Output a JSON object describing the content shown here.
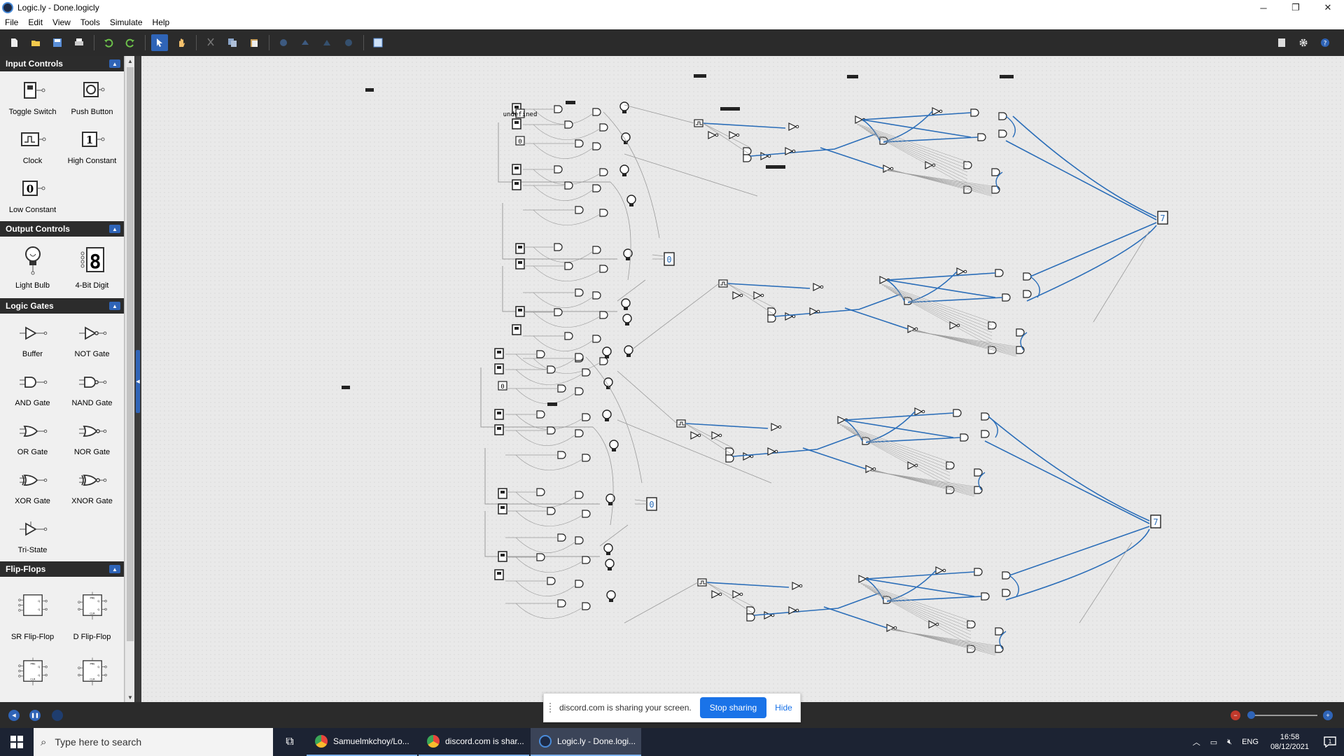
{
  "window": {
    "title": "Logic.ly - Done.logicly",
    "minimize": "─",
    "maximize": "❐",
    "close": "✕"
  },
  "menu": [
    "File",
    "Edit",
    "View",
    "Tools",
    "Simulate",
    "Help"
  ],
  "toolbar_icons": [
    "new-file-icon",
    "open-folder-icon",
    "save-icon",
    "print-icon",
    "undo-icon",
    "redo-icon",
    "select-pointer-icon",
    "pan-hand-icon",
    "cut-icon",
    "copy-icon",
    "paste-icon",
    "group-icon",
    "ungroup-icon",
    "rotate-icon",
    "flip-icon",
    "integrated-circuit-icon"
  ],
  "palette": {
    "sections": [
      {
        "title": "Input Controls",
        "items": [
          {
            "label": "Toggle Switch",
            "icon": "toggle-switch-icon"
          },
          {
            "label": "Push Button",
            "icon": "push-button-icon"
          },
          {
            "label": "Clock",
            "icon": "clock-icon"
          },
          {
            "label": "High Constant",
            "icon": "high-constant-icon",
            "glyph": "1"
          },
          {
            "label": "Low Constant",
            "icon": "low-constant-icon",
            "glyph": "0"
          }
        ]
      },
      {
        "title": "Output Controls",
        "items": [
          {
            "label": "Light Bulb",
            "icon": "light-bulb-icon"
          },
          {
            "label": "4-Bit Digit",
            "icon": "digit-display-icon",
            "glyph": "8"
          }
        ]
      },
      {
        "title": "Logic Gates",
        "items": [
          {
            "label": "Buffer",
            "icon": "buffer-gate-icon"
          },
          {
            "label": "NOT Gate",
            "icon": "not-gate-icon"
          },
          {
            "label": "AND Gate",
            "icon": "and-gate-icon"
          },
          {
            "label": "NAND Gate",
            "icon": "nand-gate-icon"
          },
          {
            "label": "OR Gate",
            "icon": "or-gate-icon"
          },
          {
            "label": "NOR Gate",
            "icon": "nor-gate-icon"
          },
          {
            "label": "XOR Gate",
            "icon": "xor-gate-icon"
          },
          {
            "label": "XNOR Gate",
            "icon": "xnor-gate-icon"
          },
          {
            "label": "Tri-State",
            "icon": "tri-state-icon"
          }
        ]
      },
      {
        "title": "Flip-Flops",
        "items": [
          {
            "label": "SR Flip-Flop",
            "icon": "sr-flip-flop-icon"
          },
          {
            "label": "D Flip-Flop",
            "icon": "d-flip-flop-icon"
          },
          {
            "label": "",
            "icon": "jk-flip-flop-icon"
          },
          {
            "label": "",
            "icon": "t-flip-flop-icon"
          }
        ]
      }
    ]
  },
  "circuit": {
    "constant_labels": [
      "0",
      "0"
    ],
    "digit_values": [
      "0",
      "0",
      "7",
      "7"
    ]
  },
  "share_banner": {
    "message": "discord.com is sharing your screen.",
    "stop_label": "Stop sharing",
    "hide_label": "Hide"
  },
  "taskbar": {
    "search_placeholder": "Type here to search",
    "apps": [
      {
        "label": "Samuelmkchoy/Lo...",
        "color": "#e8453c"
      },
      {
        "label": "discord.com is shar...",
        "color": "#e8453c"
      },
      {
        "label": "Logic.ly - Done.logi...",
        "color": "#4a8bd8"
      }
    ],
    "language": "ENG",
    "time": "16:58",
    "date": "08/12/2021",
    "notifications": "1"
  },
  "zoom": {
    "level": 0.05
  },
  "colors": {
    "accent": "#2f64b7",
    "wire_active": "#2a6db8",
    "wire_idle": "#9a9a9a",
    "toolbar_bg": "#2b2b2b"
  }
}
